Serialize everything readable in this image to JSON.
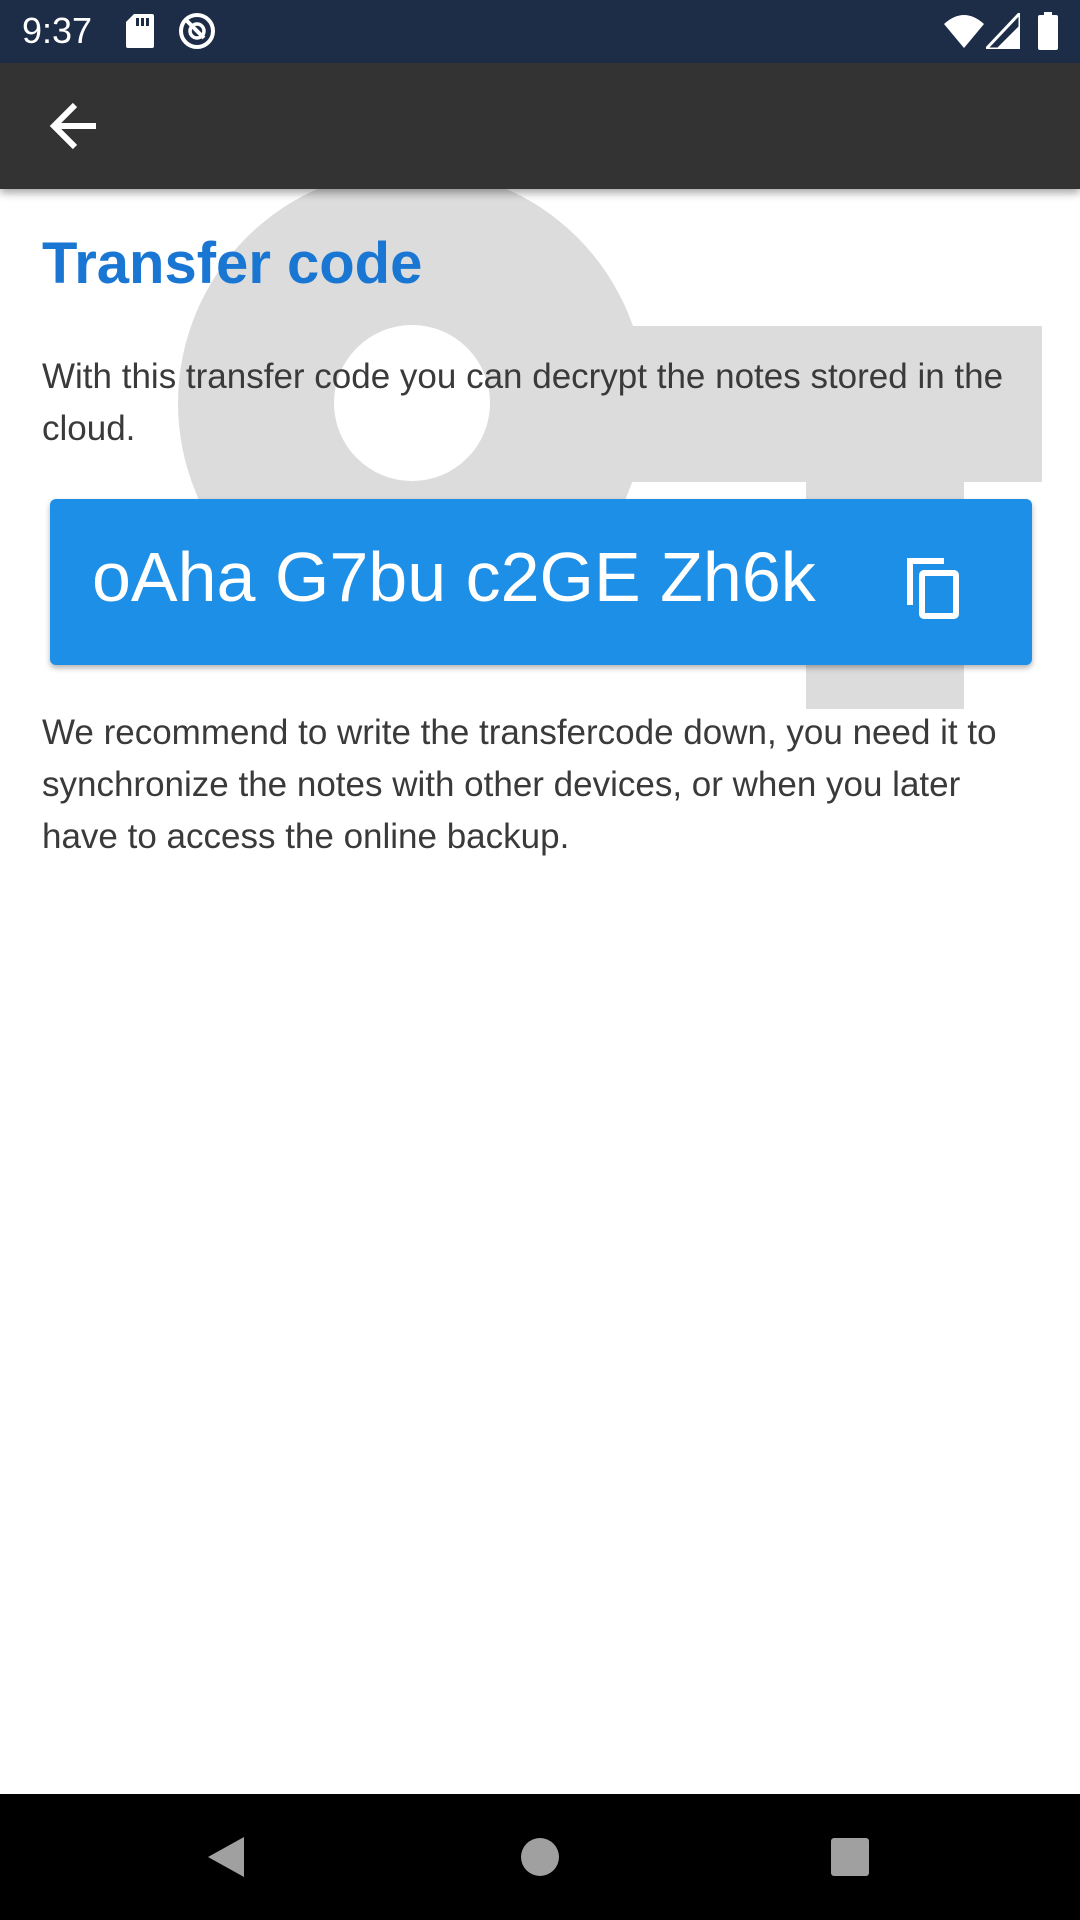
{
  "status_bar": {
    "time": "9:37",
    "left_icons": [
      "sd-card-icon",
      "app-notification-icon"
    ],
    "right_icons": [
      "wifi-icon",
      "cell-signal-icon",
      "battery-icon"
    ]
  },
  "toolbar": {
    "back_icon": "arrow-back-icon"
  },
  "main": {
    "title": "Transfer code",
    "intro": "With this transfer code you can decrypt the notes stored in the cloud.",
    "transfer_code": "oAha G7bu c2GE Zh6k",
    "copy_icon": "copy-icon",
    "recommendation": "We recommend to write the transfercode down, you need it to synchronize the notes with other devices, or when you later have to access the online backup."
  },
  "nav_bar": {
    "buttons": [
      "back-triangle-icon",
      "home-circle-icon",
      "recents-square-icon"
    ]
  },
  "colors": {
    "status_bar": "#1e2d47",
    "toolbar": "#333333",
    "accent": "#1976d2",
    "code_card": "#1e8fe7",
    "key_background": "#dcdcdc",
    "body_text": "#3a3a3a"
  }
}
